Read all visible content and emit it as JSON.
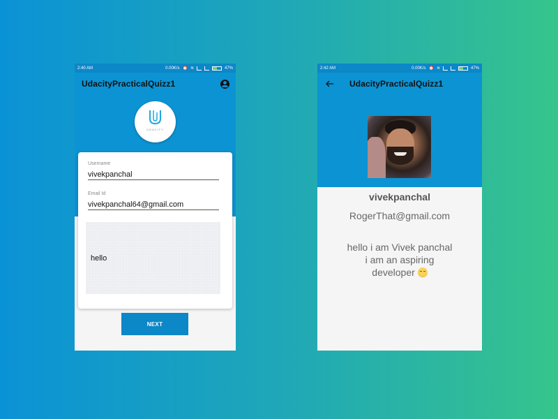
{
  "left_screen": {
    "status": {
      "time": "2:40 AM",
      "speed": "0.00K/s",
      "battery": "47%",
      "battery_level": 0.47
    },
    "appbar": {
      "title": "UdacityPracticalQuizz1"
    },
    "logo": {
      "text": "UDACITY"
    },
    "form": {
      "username_label": "Username",
      "username_value": "vivekpanchal",
      "email_label": "Email Id",
      "email_value": "vivekpanchal64@gmail.com",
      "bio_value": "hello"
    },
    "next_label": "NEXT"
  },
  "right_screen": {
    "status": {
      "time": "2:42 AM",
      "speed": "0.00K/s",
      "battery": "47%",
      "battery_level": 0.47
    },
    "appbar": {
      "title": "UdacityPracticalQuizz1"
    },
    "profile": {
      "name": "vivekpanchal",
      "email": "RogerThat@gmail.com",
      "bio_line1": "hello i am Vivek panchal",
      "bio_line2": "i am an aspiring",
      "bio_line3": "developer"
    }
  },
  "colors": {
    "primary": "#0c93d3",
    "primary_dark": "#0c87c7",
    "accent_button": "#0c87c7",
    "background_gradient_start": "#0a92d6",
    "background_gradient_end": "#36c48c"
  },
  "icons": [
    "account-circle-icon",
    "back-arrow-icon",
    "wifi-icon",
    "signal-icon",
    "battery-icon",
    "alarm-icon",
    "smile-emoji-icon"
  ]
}
